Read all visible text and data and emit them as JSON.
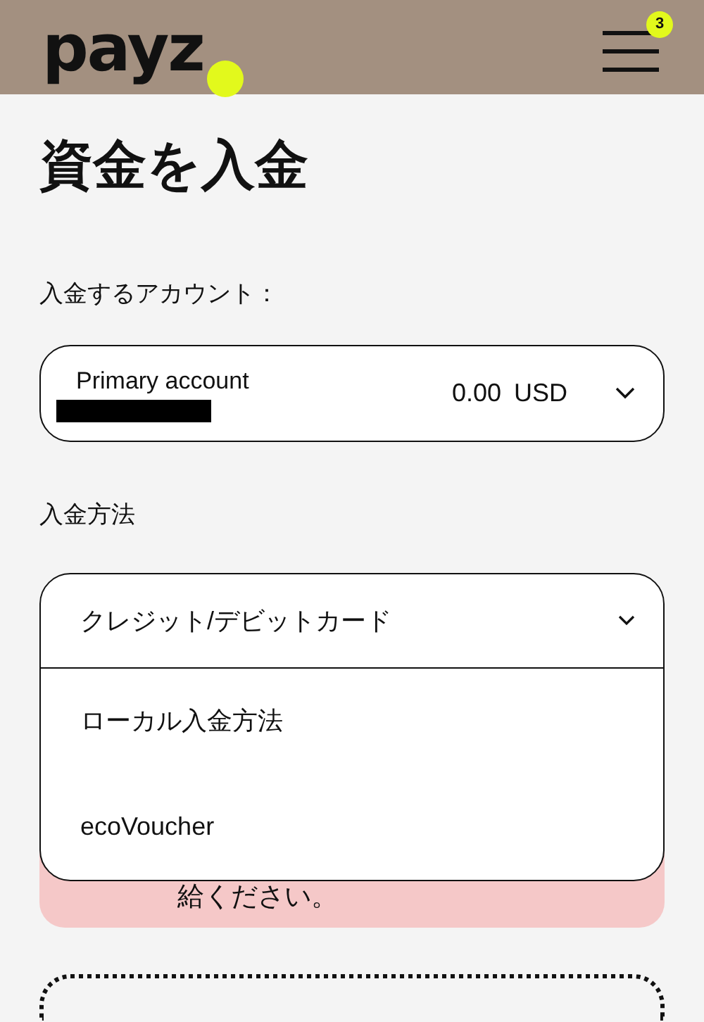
{
  "header": {
    "logo": "payz",
    "menu_badge": "3"
  },
  "title": "資金を入金",
  "account_label": "入金するアカウント：",
  "account_select": {
    "name": "Primary account",
    "balance": "0.00",
    "currency": "USD"
  },
  "method_label": "入金方法",
  "method_select": {
    "value": "クレジット/デビットカード",
    "expanded": true,
    "options": [
      {
        "label": "ローカル入金方法"
      },
      {
        "label": "ecoVoucher"
      }
    ]
  },
  "alert": {
    "text": "給ください。"
  }
}
